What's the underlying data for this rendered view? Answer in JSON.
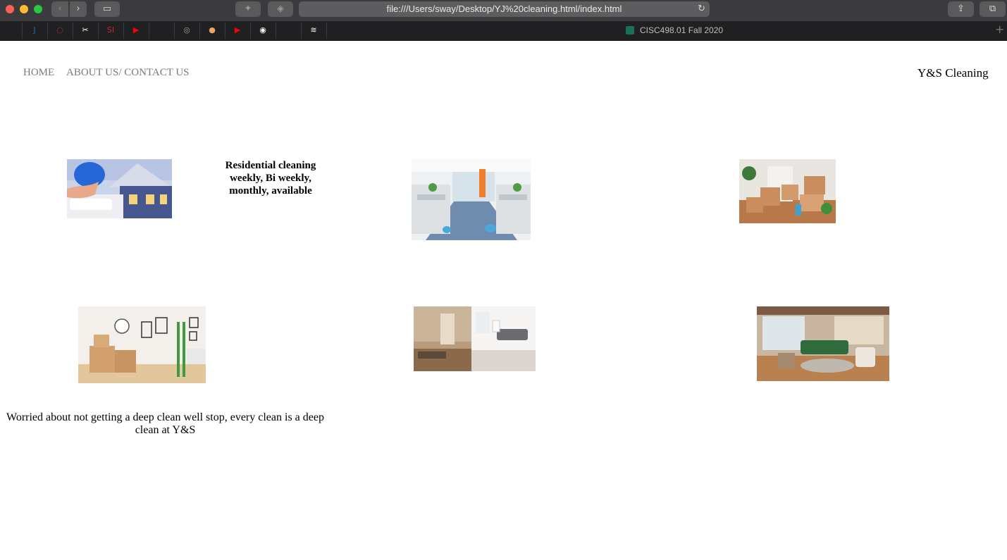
{
  "browser": {
    "url": "file:///Users/sway/Desktop/YJ%20cleaning.html/index.html",
    "active_tab_title": "CISC498.01 Fall 2020"
  },
  "favorites": [
    {
      "name": "j-icon",
      "glyph": "J",
      "color": "#1a73b8"
    },
    {
      "name": "ring-icon",
      "glyph": "◌",
      "color": "#e53935"
    },
    {
      "name": "tools-icon",
      "glyph": "✂",
      "color": "#ffffff"
    },
    {
      "name": "si-icon",
      "glyph": "SI",
      "color": "#c62828"
    },
    {
      "name": "youtube-icon",
      "glyph": "▶",
      "color": "#ff0000"
    },
    {
      "name": "blank-icon",
      "glyph": "",
      "color": "#2c2c2e"
    },
    {
      "name": "compass-icon",
      "glyph": "◎",
      "color": "#9e9e9e"
    },
    {
      "name": "orange-icon",
      "glyph": "●",
      "color": "#f4a261"
    },
    {
      "name": "youtube-icon",
      "glyph": "▶",
      "color": "#ff0000"
    },
    {
      "name": "github-icon",
      "glyph": "◉",
      "color": "#ffffff"
    },
    {
      "name": "blank-icon",
      "glyph": "",
      "color": "#2c2c2e"
    },
    {
      "name": "rss-icon",
      "glyph": "≋",
      "color": "#ffffff"
    },
    {
      "name": "blank-icon",
      "glyph": "",
      "color": "#2c2c2e"
    }
  ],
  "nav": {
    "home": "HOME",
    "about": "ABOUT US/ CONTACT US",
    "brand": "Y&S Cleaning"
  },
  "content": {
    "residential": "Residential cleaning weekly, Bi weekly, monthly, available",
    "deep_clean": "Worried about not getting a deep clean well stop, every clean is a deep clean at Y&S"
  }
}
